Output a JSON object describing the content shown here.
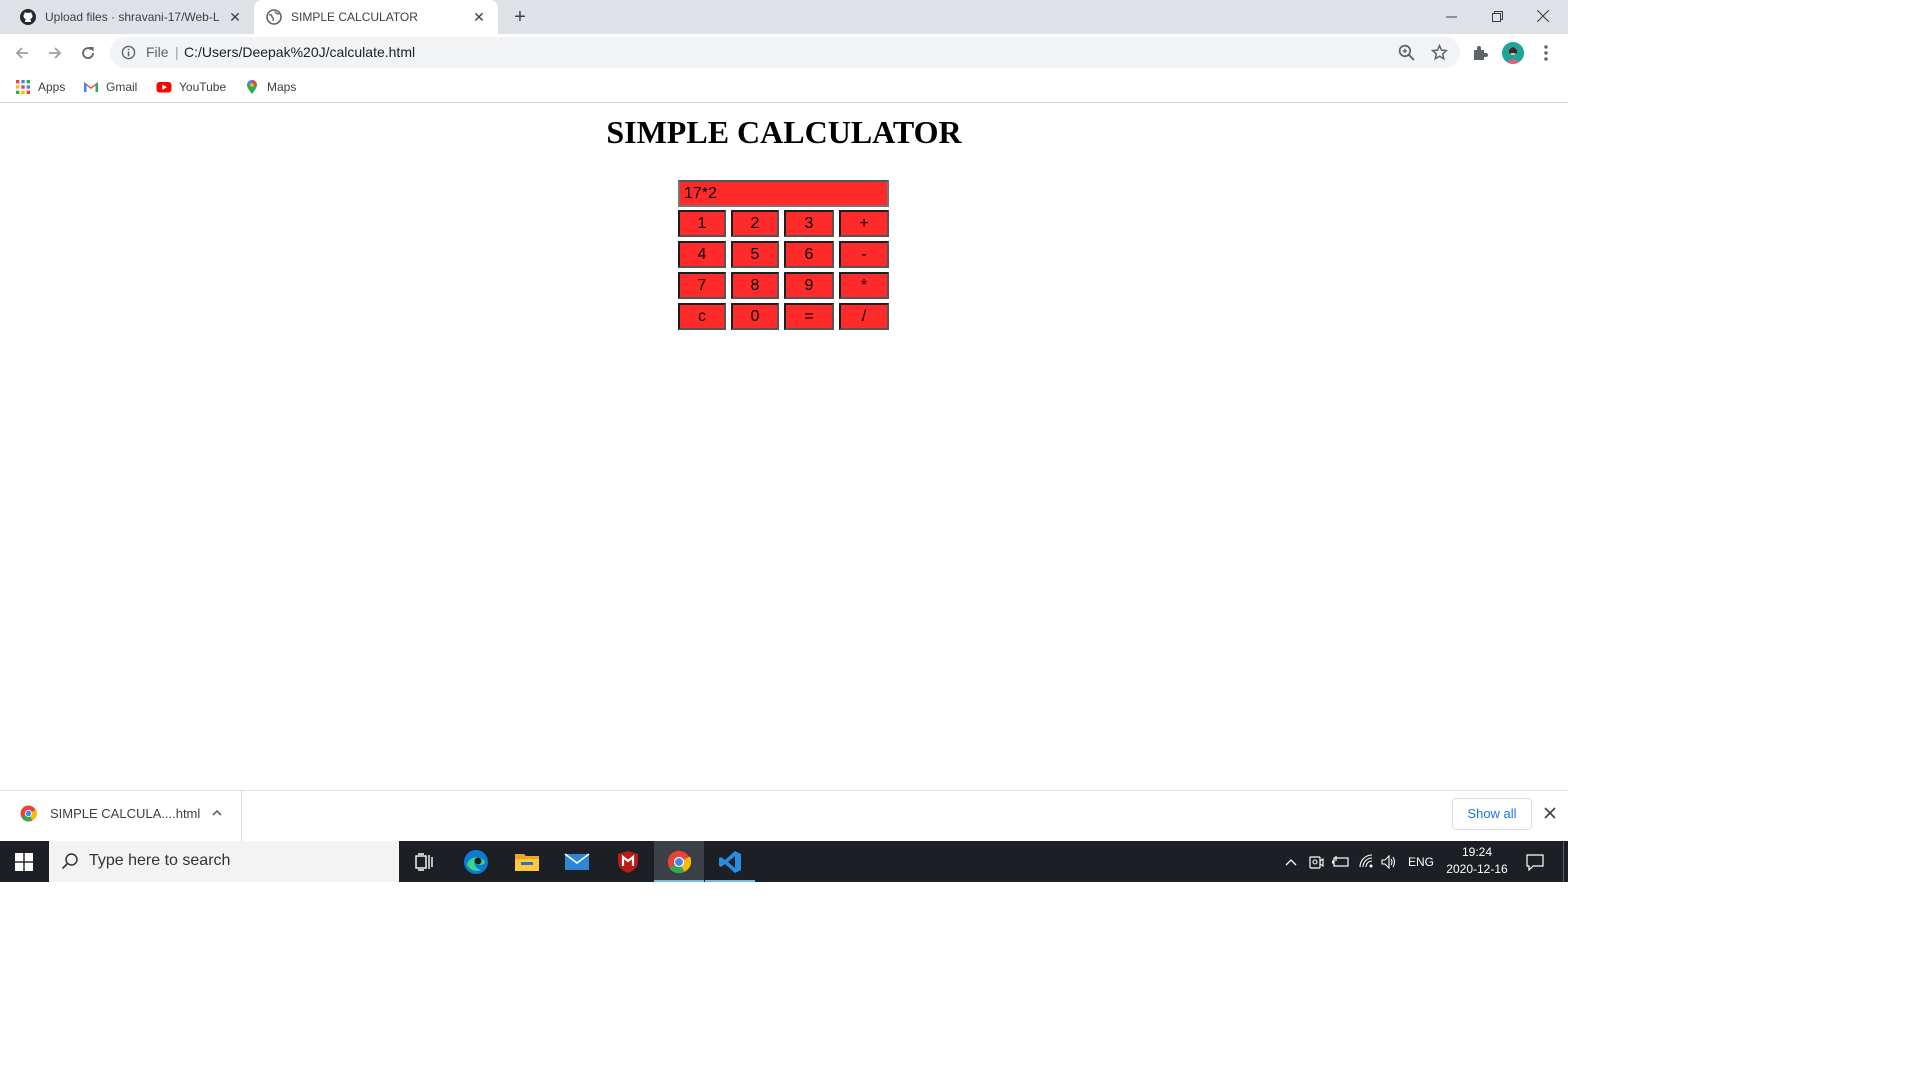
{
  "browser": {
    "tabs": [
      {
        "title": "Upload files · shravani-17/Web-L",
        "icon": "github-icon"
      },
      {
        "title": "SIMPLE CALCULATOR",
        "icon": "globe-icon"
      }
    ],
    "address_bar": {
      "scheme_label": "File",
      "url": "C:/Users/Deepak%20J/calculate.html"
    },
    "bookmarks": [
      "Apps",
      "Gmail",
      "YouTube",
      "Maps"
    ]
  },
  "page": {
    "title": "SIMPLE CALCULATOR",
    "display_value": "17*2",
    "accent_color": "#ff2a2a",
    "keys": [
      "1",
      "2",
      "3",
      "+",
      "4",
      "5",
      "6",
      "-",
      "7",
      "8",
      "9",
      "*",
      "c",
      "0",
      "=",
      "/"
    ]
  },
  "downloads": {
    "item_name": "SIMPLE CALCULA....html",
    "show_all": "Show all"
  },
  "taskbar": {
    "search_placeholder": "Type here to search",
    "language": "ENG",
    "time": "19:24",
    "date": "2020-12-16"
  }
}
